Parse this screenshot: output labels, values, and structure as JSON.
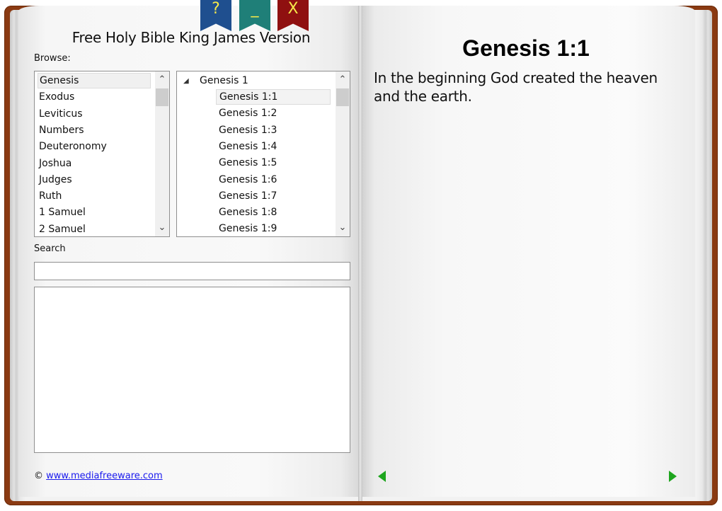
{
  "ribbons": {
    "help": "?",
    "minimize": "_",
    "close": "X"
  },
  "app_title": "Free Holy Bible King James Version",
  "browse_label": "Browse:",
  "books": [
    "Genesis",
    "Exodus",
    "Leviticus",
    "Numbers",
    "Deuteronomy",
    "Joshua",
    "Judges",
    "Ruth",
    "1 Samuel",
    "2 Samuel"
  ],
  "selected_book": "Genesis",
  "tree": {
    "chapter": "Genesis 1",
    "expander": "◢",
    "verses": [
      "Genesis 1:1",
      "Genesis 1:2",
      "Genesis 1:3",
      "Genesis 1:4",
      "Genesis 1:5",
      "Genesis 1:6",
      "Genesis 1:7",
      "Genesis 1:8",
      "Genesis 1:9"
    ],
    "selected_verse": "Genesis 1:1"
  },
  "search": {
    "label": "Search",
    "value": "",
    "placeholder": ""
  },
  "footer": {
    "copyright": "©",
    "link": "www.mediafreeware.com"
  },
  "reader": {
    "title": "Genesis 1:1",
    "text": "In the beginning God created the heaven and the earth."
  },
  "colors": {
    "cover": "#8a3a12",
    "nav_arrow": "#1ea51e",
    "ribbon_help": "#1f4f8f",
    "ribbon_min": "#1f7f78",
    "ribbon_close": "#8f1010",
    "ribbon_glyph": "#f5e84a"
  }
}
